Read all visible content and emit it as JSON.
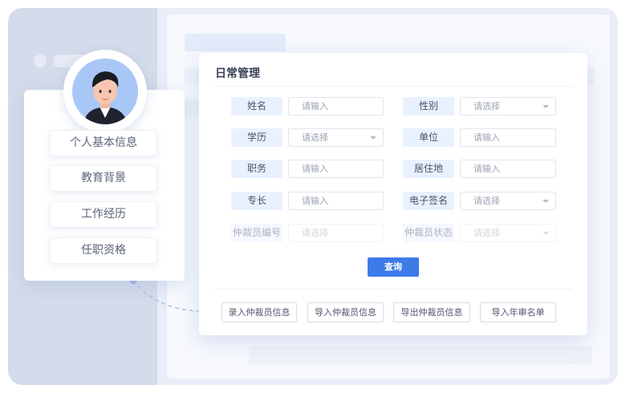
{
  "profile": {
    "menu": [
      {
        "label": "个人基本信息"
      },
      {
        "label": "教育背景"
      },
      {
        "label": "工作经历"
      },
      {
        "label": "任职资格"
      }
    ]
  },
  "form": {
    "title": "日常管理",
    "fields": {
      "name": {
        "label": "姓名",
        "placeholder": "请输入"
      },
      "gender": {
        "label": "性别",
        "placeholder": "请选择"
      },
      "education": {
        "label": "学历",
        "placeholder": "请选择"
      },
      "unit": {
        "label": "单位",
        "placeholder": "请输入"
      },
      "position": {
        "label": "职务",
        "placeholder": "请输入"
      },
      "residence": {
        "label": "居住地",
        "placeholder": "请输入"
      },
      "specialty": {
        "label": "专长",
        "placeholder": "请输入"
      },
      "esign": {
        "label": "电子签名",
        "placeholder": "请选择"
      },
      "arbiter_no": {
        "label": "仲裁员编号",
        "placeholder": "请选择"
      },
      "arbiter_status": {
        "label": "仲裁员状态",
        "placeholder": "请选择"
      }
    },
    "query_label": "查询",
    "actions": [
      {
        "label": "录入仲裁员信息"
      },
      {
        "label": "导入仲裁员信息"
      },
      {
        "label": "导出仲裁员信息"
      },
      {
        "label": "导入年审名单"
      }
    ]
  },
  "colors": {
    "accent": "#3d7be8",
    "label_bg": "#eaf1fe",
    "avatar_bg": "#a8c7f7"
  }
}
